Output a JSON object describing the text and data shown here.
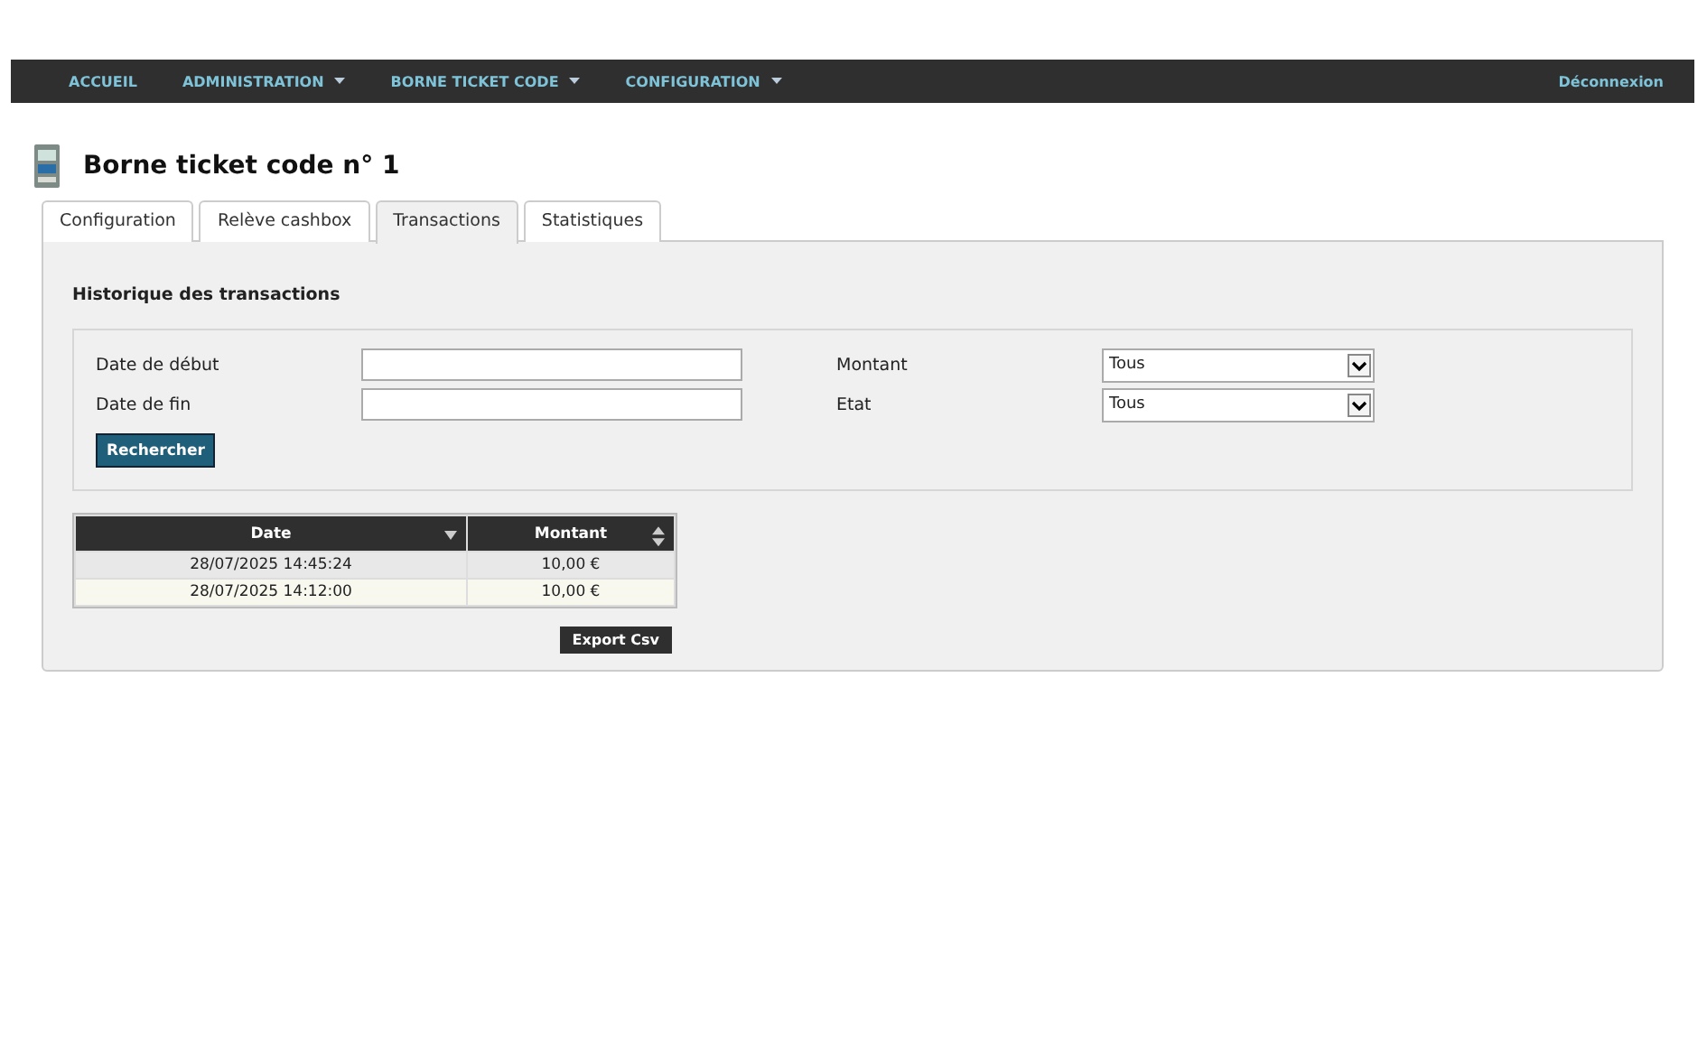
{
  "nav": {
    "items": [
      {
        "label": "ACCUEIL",
        "dropdown": false
      },
      {
        "label": "ADMINISTRATION",
        "dropdown": true
      },
      {
        "label": "BORNE TICKET CODE",
        "dropdown": true
      },
      {
        "label": "CONFIGURATION",
        "dropdown": true
      }
    ],
    "logout": "Déconnexion"
  },
  "page_title": "Borne ticket code n° 1",
  "tabs": [
    {
      "label": "Configuration",
      "selected": false
    },
    {
      "label": "Relève cashbox",
      "selected": false
    },
    {
      "label": "Transactions",
      "selected": true
    },
    {
      "label": "Statistiques",
      "selected": false
    }
  ],
  "section_title": "Historique des transactions",
  "filters": {
    "fields": [
      {
        "label": "Date de début"
      },
      {
        "label": "Date de fin"
      }
    ],
    "selects": [
      {
        "label": "Montant",
        "value": "Tous"
      },
      {
        "label": "Etat",
        "value": "Tous"
      }
    ],
    "search_button": "Rechercher"
  },
  "table": {
    "columns": [
      {
        "label": "Date",
        "sorted": true
      },
      {
        "label": "Montant",
        "sorted": false
      }
    ],
    "rows": [
      [
        "28/07/2025 14:45:24",
        "10,00 €"
      ],
      [
        "28/07/2025 14:12:00",
        "10,00 €"
      ]
    ]
  },
  "export_button": "Export Csv"
}
